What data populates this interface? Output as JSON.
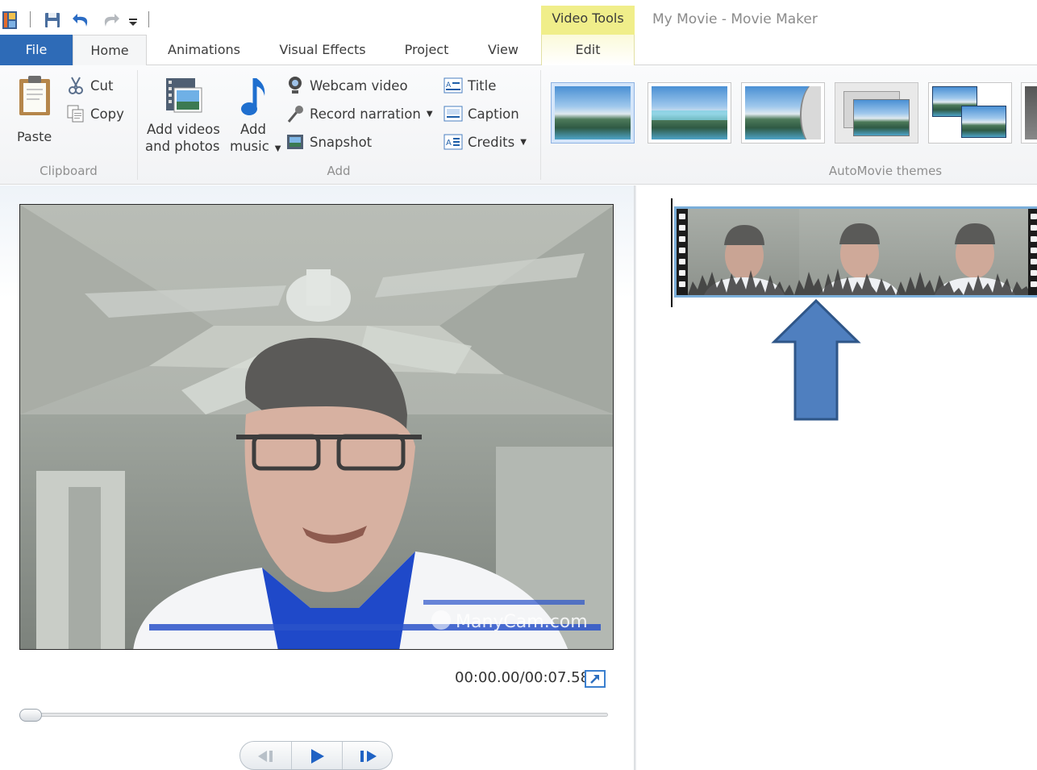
{
  "window": {
    "title": "My Movie - Movie Maker",
    "contextual_group": "Video Tools"
  },
  "tabs": [
    {
      "label": "File",
      "selected": false
    },
    {
      "label": "Home",
      "selected": true
    },
    {
      "label": "Animations",
      "selected": false
    },
    {
      "label": "Visual Effects",
      "selected": false
    },
    {
      "label": "Project",
      "selected": false
    },
    {
      "label": "View",
      "selected": false
    },
    {
      "label": "Edit",
      "selected": false
    }
  ],
  "ribbon": {
    "clipboard": {
      "label": "Clipboard",
      "paste": "Paste",
      "cut": "Cut",
      "copy": "Copy"
    },
    "add": {
      "label": "Add",
      "add_videos_line1": "Add videos",
      "add_videos_line2": "and photos",
      "add_music_line1": "Add",
      "add_music_line2": "music",
      "webcam_video": "Webcam video",
      "record_narration": "Record narration",
      "snapshot": "Snapshot",
      "title": "Title",
      "caption": "Caption",
      "credits": "Credits"
    },
    "themes": {
      "label": "AutoMovie themes",
      "selected_index": 0
    }
  },
  "preview": {
    "time": "00:00.00/00:07.58",
    "watermark": "ManyCam.com",
    "seek_position": 0
  },
  "colors": {
    "file_tab": "#2e6bb7",
    "contextual_tab": "#f0ee8a",
    "selection_border": "#7aaed9",
    "arrow_fill": "#4f7fbf",
    "arrow_stroke": "#2f5688"
  }
}
